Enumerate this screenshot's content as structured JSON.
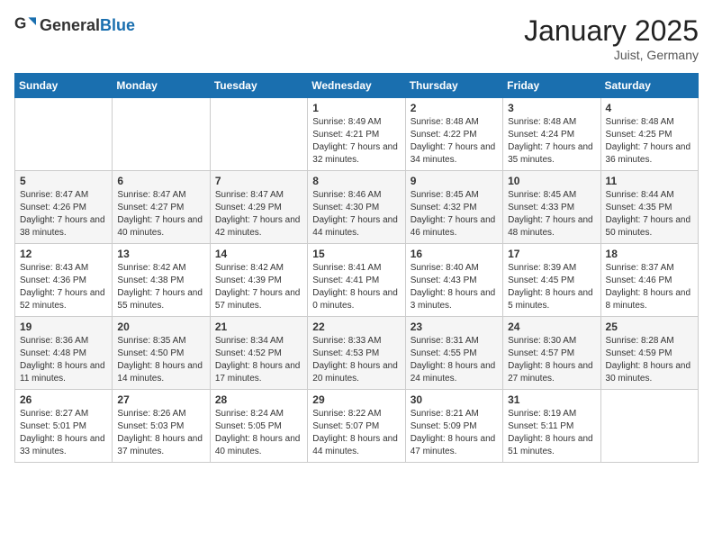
{
  "header": {
    "logo_general": "General",
    "logo_blue": "Blue",
    "month": "January 2025",
    "location": "Juist, Germany"
  },
  "weekdays": [
    "Sunday",
    "Monday",
    "Tuesday",
    "Wednesday",
    "Thursday",
    "Friday",
    "Saturday"
  ],
  "weeks": [
    [
      {
        "day": "",
        "sunrise": "",
        "sunset": "",
        "daylight": ""
      },
      {
        "day": "",
        "sunrise": "",
        "sunset": "",
        "daylight": ""
      },
      {
        "day": "",
        "sunrise": "",
        "sunset": "",
        "daylight": ""
      },
      {
        "day": "1",
        "sunrise": "Sunrise: 8:49 AM",
        "sunset": "Sunset: 4:21 PM",
        "daylight": "Daylight: 7 hours and 32 minutes."
      },
      {
        "day": "2",
        "sunrise": "Sunrise: 8:48 AM",
        "sunset": "Sunset: 4:22 PM",
        "daylight": "Daylight: 7 hours and 34 minutes."
      },
      {
        "day": "3",
        "sunrise": "Sunrise: 8:48 AM",
        "sunset": "Sunset: 4:24 PM",
        "daylight": "Daylight: 7 hours and 35 minutes."
      },
      {
        "day": "4",
        "sunrise": "Sunrise: 8:48 AM",
        "sunset": "Sunset: 4:25 PM",
        "daylight": "Daylight: 7 hours and 36 minutes."
      }
    ],
    [
      {
        "day": "5",
        "sunrise": "Sunrise: 8:47 AM",
        "sunset": "Sunset: 4:26 PM",
        "daylight": "Daylight: 7 hours and 38 minutes."
      },
      {
        "day": "6",
        "sunrise": "Sunrise: 8:47 AM",
        "sunset": "Sunset: 4:27 PM",
        "daylight": "Daylight: 7 hours and 40 minutes."
      },
      {
        "day": "7",
        "sunrise": "Sunrise: 8:47 AM",
        "sunset": "Sunset: 4:29 PM",
        "daylight": "Daylight: 7 hours and 42 minutes."
      },
      {
        "day": "8",
        "sunrise": "Sunrise: 8:46 AM",
        "sunset": "Sunset: 4:30 PM",
        "daylight": "Daylight: 7 hours and 44 minutes."
      },
      {
        "day": "9",
        "sunrise": "Sunrise: 8:45 AM",
        "sunset": "Sunset: 4:32 PM",
        "daylight": "Daylight: 7 hours and 46 minutes."
      },
      {
        "day": "10",
        "sunrise": "Sunrise: 8:45 AM",
        "sunset": "Sunset: 4:33 PM",
        "daylight": "Daylight: 7 hours and 48 minutes."
      },
      {
        "day": "11",
        "sunrise": "Sunrise: 8:44 AM",
        "sunset": "Sunset: 4:35 PM",
        "daylight": "Daylight: 7 hours and 50 minutes."
      }
    ],
    [
      {
        "day": "12",
        "sunrise": "Sunrise: 8:43 AM",
        "sunset": "Sunset: 4:36 PM",
        "daylight": "Daylight: 7 hours and 52 minutes."
      },
      {
        "day": "13",
        "sunrise": "Sunrise: 8:42 AM",
        "sunset": "Sunset: 4:38 PM",
        "daylight": "Daylight: 7 hours and 55 minutes."
      },
      {
        "day": "14",
        "sunrise": "Sunrise: 8:42 AM",
        "sunset": "Sunset: 4:39 PM",
        "daylight": "Daylight: 7 hours and 57 minutes."
      },
      {
        "day": "15",
        "sunrise": "Sunrise: 8:41 AM",
        "sunset": "Sunset: 4:41 PM",
        "daylight": "Daylight: 8 hours and 0 minutes."
      },
      {
        "day": "16",
        "sunrise": "Sunrise: 8:40 AM",
        "sunset": "Sunset: 4:43 PM",
        "daylight": "Daylight: 8 hours and 3 minutes."
      },
      {
        "day": "17",
        "sunrise": "Sunrise: 8:39 AM",
        "sunset": "Sunset: 4:45 PM",
        "daylight": "Daylight: 8 hours and 5 minutes."
      },
      {
        "day": "18",
        "sunrise": "Sunrise: 8:37 AM",
        "sunset": "Sunset: 4:46 PM",
        "daylight": "Daylight: 8 hours and 8 minutes."
      }
    ],
    [
      {
        "day": "19",
        "sunrise": "Sunrise: 8:36 AM",
        "sunset": "Sunset: 4:48 PM",
        "daylight": "Daylight: 8 hours and 11 minutes."
      },
      {
        "day": "20",
        "sunrise": "Sunrise: 8:35 AM",
        "sunset": "Sunset: 4:50 PM",
        "daylight": "Daylight: 8 hours and 14 minutes."
      },
      {
        "day": "21",
        "sunrise": "Sunrise: 8:34 AM",
        "sunset": "Sunset: 4:52 PM",
        "daylight": "Daylight: 8 hours and 17 minutes."
      },
      {
        "day": "22",
        "sunrise": "Sunrise: 8:33 AM",
        "sunset": "Sunset: 4:53 PM",
        "daylight": "Daylight: 8 hours and 20 minutes."
      },
      {
        "day": "23",
        "sunrise": "Sunrise: 8:31 AM",
        "sunset": "Sunset: 4:55 PM",
        "daylight": "Daylight: 8 hours and 24 minutes."
      },
      {
        "day": "24",
        "sunrise": "Sunrise: 8:30 AM",
        "sunset": "Sunset: 4:57 PM",
        "daylight": "Daylight: 8 hours and 27 minutes."
      },
      {
        "day": "25",
        "sunrise": "Sunrise: 8:28 AM",
        "sunset": "Sunset: 4:59 PM",
        "daylight": "Daylight: 8 hours and 30 minutes."
      }
    ],
    [
      {
        "day": "26",
        "sunrise": "Sunrise: 8:27 AM",
        "sunset": "Sunset: 5:01 PM",
        "daylight": "Daylight: 8 hours and 33 minutes."
      },
      {
        "day": "27",
        "sunrise": "Sunrise: 8:26 AM",
        "sunset": "Sunset: 5:03 PM",
        "daylight": "Daylight: 8 hours and 37 minutes."
      },
      {
        "day": "28",
        "sunrise": "Sunrise: 8:24 AM",
        "sunset": "Sunset: 5:05 PM",
        "daylight": "Daylight: 8 hours and 40 minutes."
      },
      {
        "day": "29",
        "sunrise": "Sunrise: 8:22 AM",
        "sunset": "Sunset: 5:07 PM",
        "daylight": "Daylight: 8 hours and 44 minutes."
      },
      {
        "day": "30",
        "sunrise": "Sunrise: 8:21 AM",
        "sunset": "Sunset: 5:09 PM",
        "daylight": "Daylight: 8 hours and 47 minutes."
      },
      {
        "day": "31",
        "sunrise": "Sunrise: 8:19 AM",
        "sunset": "Sunset: 5:11 PM",
        "daylight": "Daylight: 8 hours and 51 minutes."
      },
      {
        "day": "",
        "sunrise": "",
        "sunset": "",
        "daylight": ""
      }
    ]
  ]
}
